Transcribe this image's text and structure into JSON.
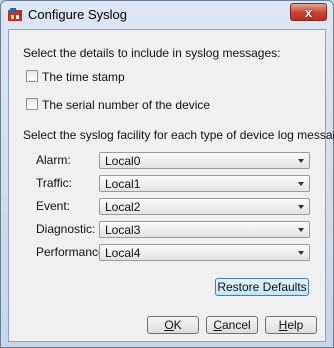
{
  "window": {
    "title": "Configure Syslog",
    "close_glyph": "x"
  },
  "details": {
    "heading": "Select the details to include in syslog messages:",
    "options": [
      {
        "label": "The time stamp",
        "checked": false
      },
      {
        "label": "The serial number of the device",
        "checked": false
      }
    ]
  },
  "facility": {
    "heading": "Select the syslog facility for each type of device log message.",
    "rows": [
      {
        "label": "Alarm:",
        "value": "Local0"
      },
      {
        "label": "Traffic:",
        "value": "Local1"
      },
      {
        "label": "Event:",
        "value": "Local2"
      },
      {
        "label": "Diagnostic:",
        "value": "Local3"
      },
      {
        "label": "Performance:",
        "value": "Local4"
      }
    ]
  },
  "buttons": {
    "restore_defaults": "Restore Defaults",
    "ok_mnemonic": "O",
    "ok_rest": "K",
    "cancel_mnemonic": "C",
    "cancel_rest": "ancel",
    "help_mnemonic": "H",
    "help_rest": "elp"
  },
  "colors": {
    "client_bg": "#f0f0f0",
    "default_button": "#bee6fd",
    "close_button": "#c9452f"
  },
  "icons": {
    "app": "firebox-app-icon",
    "dropdown": "chevron-down-icon"
  }
}
